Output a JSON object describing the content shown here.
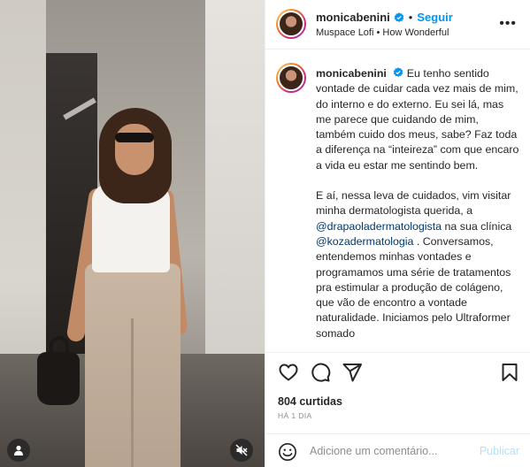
{
  "post": {
    "username": "monicabenini",
    "verified": true,
    "follow_label": "Seguir",
    "separator": "•",
    "audio": "Muspace Lofi • How Wonderful",
    "more_label": "•••"
  },
  "caption": {
    "username": "monicabenini",
    "paragraph1": "Eu tenho sentido vontade de cuidar cada vez mais de mim, do interno e do externo. Eu sei lá, mas me parece que cuidando de mim, também cuido dos meus, sabe? Faz toda a diferença na “inteireza” com que encaro a vida eu estar me sentindo bem.",
    "p2_text1": "E aí, nessa leva de cuidados, vim visitar minha dermatologista querida, a ",
    "p2_mention1": "@drapaoladermatologista",
    "p2_text2": " na sua clínica ",
    "p2_mention2": "@kozadermatologia",
    "p2_text3": " . Conversamos, entendemos minhas vontades e programamos uma série de tratamentos pra estimular a produção de colágeno, que vão de encontro a vontade naturalidade. Iniciamos pelo Ultraformer somado"
  },
  "engagement": {
    "likes": "804 curtidas",
    "date": "HÁ 1 DIA"
  },
  "comment_box": {
    "placeholder": "Adicione um comentário...",
    "publish_label": "Publicar"
  },
  "icons": {
    "verified": "verified-badge-icon",
    "like": "heart-icon",
    "comment": "comment-icon",
    "share": "paper-plane-icon",
    "save": "bookmark-icon",
    "emoji": "smiley-icon",
    "user_tag": "person-icon",
    "mute": "speaker-muted-icon"
  },
  "colors": {
    "accent": "#0095f6",
    "mention": "#00376b",
    "publish_disabled": "#b2dffc",
    "secondary_text": "#8e8e8e"
  }
}
